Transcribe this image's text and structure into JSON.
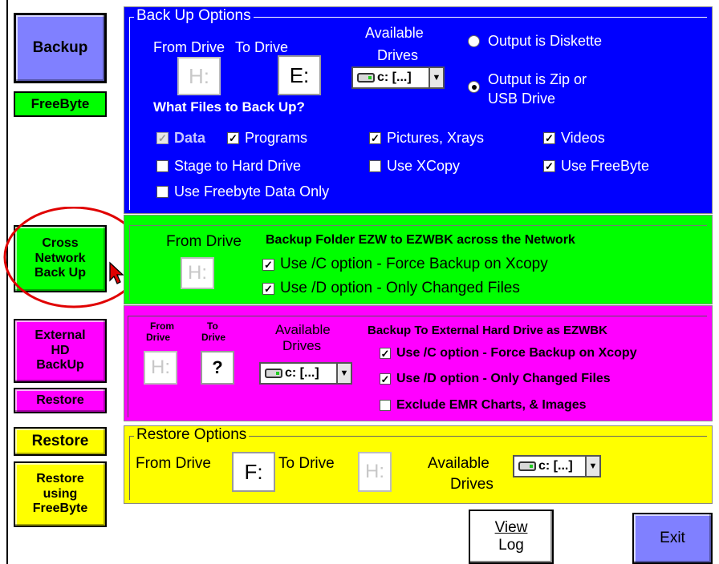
{
  "left_buttons": {
    "backup": "Backup",
    "freebyte": "FreeByte",
    "cross_network": "Cross Network Back Up",
    "external_hd": "External HD BackUp",
    "restore_small": "Restore",
    "restore": "Restore",
    "restore_freebyte": "Restore using FreeByte"
  },
  "backup_options": {
    "title": "Back Up Options",
    "from_drive_label": "From Drive",
    "to_drive_label": "To Drive",
    "available_label_1": "Available",
    "available_label_2": "Drives",
    "from_value": "H:",
    "to_value": "E:",
    "drive_combo": "c: [...]",
    "output_diskette": "Output is Diskette",
    "output_zip_1": "Output is Zip or",
    "output_zip_2": "USB Drive",
    "what_files": "What Files to Back Up?",
    "checkboxes": {
      "data": "Data",
      "programs": "Programs",
      "pictures": "Pictures, Xrays",
      "videos": "Videos",
      "stage": "Stage to Hard Drive",
      "xcopy": "Use XCopy",
      "use_freebyte": "Use FreeByte",
      "freebyte_data_only": "Use Freebyte Data Only"
    }
  },
  "network": {
    "from_drive_label": "From Drive",
    "description": "Backup Folder EZW to EZWBK across the Network",
    "from_value": "H:",
    "opt_c": "Use /C option - Force Backup on Xcopy",
    "opt_d": "Use /D option - Only Changed Files"
  },
  "external": {
    "from_label_1": "From",
    "from_label_2": "Drive",
    "to_label_1": "To",
    "to_label_2": "Drive",
    "available_label_1": "Available",
    "available_label_2": "Drives",
    "from_value": "H:",
    "to_value": "?",
    "drive_combo": "c: [...]",
    "description": "Backup To External Hard Drive as EZWBK",
    "opt_c": "Use /C option - Force Backup on Xcopy",
    "opt_d": "Use /D option - Only Changed Files",
    "opt_exclude": "Exclude EMR Charts, & Images"
  },
  "restore_options": {
    "title": "Restore Options",
    "from_drive_label": "From Drive",
    "to_drive_label": "To Drive",
    "from_value": "F:",
    "to_value": "H:",
    "available_label_1": "Available",
    "available_label_2": "Drives",
    "drive_combo": "c: [...]"
  },
  "bottom": {
    "view_log_1": "View",
    "view_log_2": "Log",
    "exit": "Exit"
  },
  "colors": {
    "blue": "#0000ff",
    "green": "#00ff00",
    "magenta": "#ff00ff",
    "yellow": "#ffff00",
    "button_blue": "#8080ff",
    "annotation_red": "#e00000"
  }
}
